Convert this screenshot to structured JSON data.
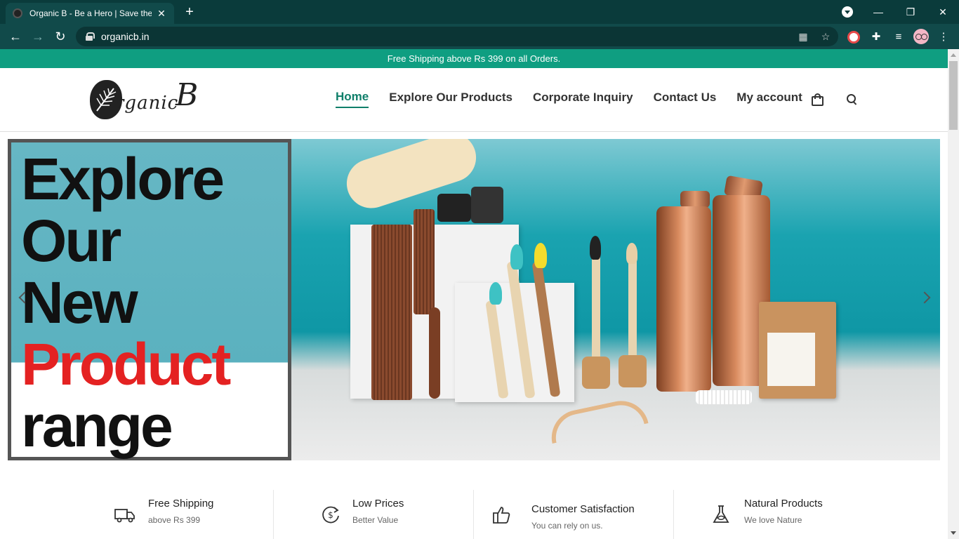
{
  "browser": {
    "tab_title": "Organic B - Be a Hero | Save the",
    "url": "organicb.in"
  },
  "promo_bar": "Free Shipping above Rs 399 on all Orders.",
  "nav": {
    "items": [
      "Home",
      "Explore Our Products",
      "Corporate Inquiry",
      "Contact Us",
      "My account"
    ]
  },
  "hero": {
    "lines": [
      "Explore",
      "Our",
      "New",
      "Product",
      "range"
    ]
  },
  "features": [
    {
      "title": "Free Shipping",
      "subtitle": "above Rs 399",
      "icon": "truck-icon"
    },
    {
      "title": "Low Prices",
      "subtitle": "Better Value",
      "icon": "dollar-cycle-icon"
    },
    {
      "title": "Customer Satisfaction",
      "subtitle": "You can rely on us.",
      "icon": "thumbs-up-icon"
    },
    {
      "title": "Natural Products",
      "subtitle": "We love Nature",
      "icon": "flask-leaf-icon"
    }
  ],
  "colors": {
    "brand_green": "#0f9e81",
    "nav_active": "#0f7f6a",
    "headline_red": "#e42222",
    "browser_frame": "#0a3b3b"
  }
}
